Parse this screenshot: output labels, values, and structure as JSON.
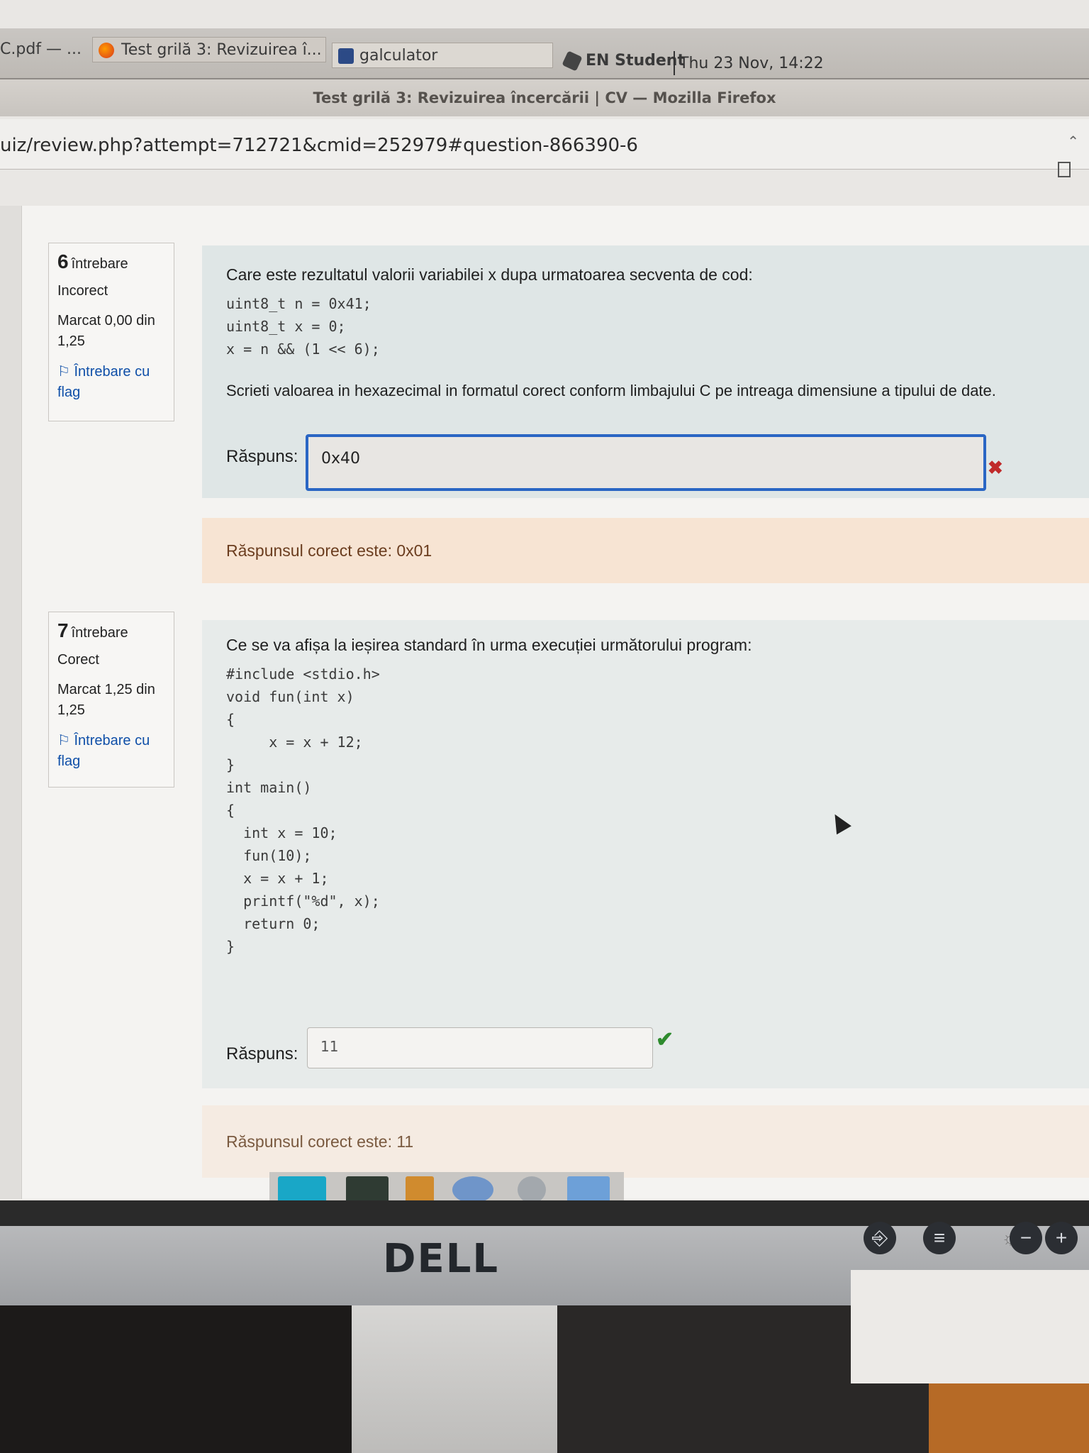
{
  "taskbar": {
    "tab_pdf": "C.pdf — ...",
    "tab_test": "Test grilă 3: Revizuirea î...",
    "tab_calc": "galculator",
    "lang_user": "EN Student",
    "clock": "Thu 23 Nov, 14:22"
  },
  "window_title": "Test grilă 3: Revizuirea încercării | CV — Mozilla Firefox",
  "url": "uiz/review.php?attempt=712721&cmid=252979#question-866390-6",
  "q6": {
    "number": "6",
    "label": "întrebare",
    "state": "Incorect",
    "grade": "Marcat 0,00 din 1,25",
    "flag": "Întrebare cu flag",
    "question": "Care este rezultatul valorii variabilei x dupa urmatoarea secventa de cod:",
    "code": "uint8_t n = 0x41;\nuint8_t x = 0;\nx = n && (1 << 6);",
    "instruction": "Scrieti valoarea in hexazecimal in formatul corect conform limbajului C pe intreaga dimensiune a tipului de date.",
    "answer_label": "Răspuns:",
    "answer_value": "0x40",
    "feedback": "Răspunsul corect este: 0x01"
  },
  "q7": {
    "number": "7",
    "label": "întrebare",
    "state": "Corect",
    "grade": "Marcat 1,25 din 1,25",
    "flag": "Întrebare cu flag",
    "question": "Ce se va afișa la ieșirea standard în urma execuției următorului program:",
    "code": "#include <stdio.h>\nvoid fun(int x)\n{\n     x = x + 12;\n}\nint main()\n{\n  int x = 10;\n  fun(10);\n  x = x + 1;\n  printf(\"%d\", x);\n  return 0;\n}",
    "answer_label": "Răspuns:",
    "answer_value": "11",
    "feedback": "Răspunsul corect este: 11"
  },
  "monitor": {
    "brand": "DELL"
  },
  "colors": {
    "incorrect_border": "#2a66c4",
    "correct_mark": "#2e8b2e",
    "incorrect_mark": "#c02a2a"
  }
}
